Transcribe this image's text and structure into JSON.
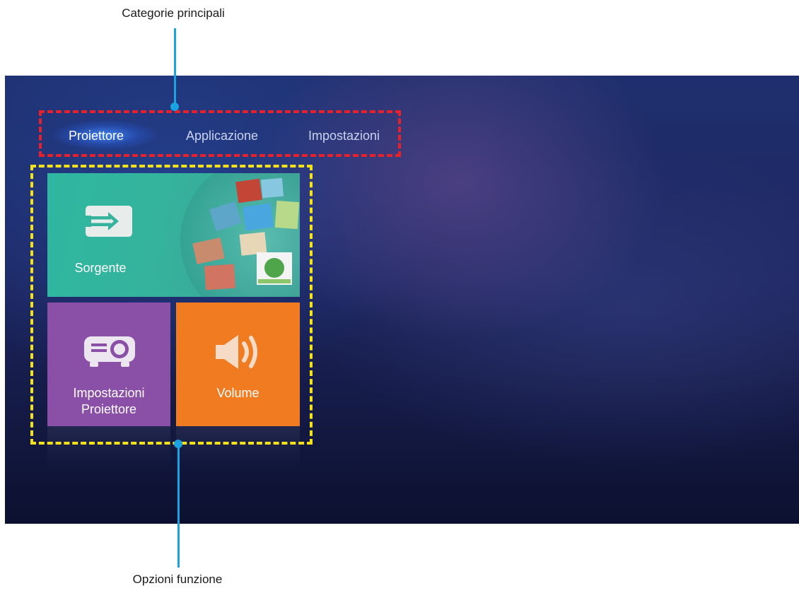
{
  "callouts": {
    "top_label": "Categorie principali",
    "bottom_label": "Opzioni funzione",
    "leader_color": "#1aa3e0",
    "category_box_color": "#e8202a",
    "options_box_color": "#f3e21a"
  },
  "menu": {
    "tabs": [
      {
        "label": "Proiettore",
        "active": true
      },
      {
        "label": "Applicazione",
        "active": false
      },
      {
        "label": "Impostazioni",
        "active": false
      }
    ]
  },
  "tiles": {
    "source": {
      "label": "Sorgente",
      "icon": "input-source-icon",
      "color": "#35b39c"
    },
    "projector_settings": {
      "label_line1": "Impostazioni",
      "label_line2": "Proiettore",
      "icon": "projector-icon",
      "color": "#8a4fa6"
    },
    "volume": {
      "label": "Volume",
      "icon": "speaker-icon",
      "color": "#f07b21"
    }
  }
}
